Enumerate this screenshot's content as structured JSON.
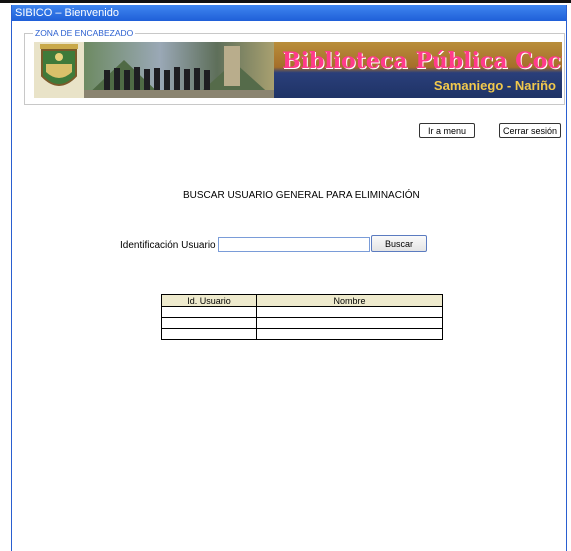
{
  "window": {
    "title": "SIBICO – Bienvenido"
  },
  "header": {
    "legend": "ZONA DE ENCABEZADO",
    "banner_title": "Biblioteca Pública Cocuyos",
    "banner_subtitle": "Samaniego - Nariño"
  },
  "nav": {
    "menu_label": "Ir a menu",
    "logout_label": "Cerrar sesión"
  },
  "search": {
    "heading": "BUSCAR USUARIO GENERAL PARA ELIMINACIÓN",
    "id_label": "Identificación Usuario",
    "id_value": "",
    "button_label": "Buscar"
  },
  "results": {
    "columns": [
      "Id. Usuario",
      "Nombre"
    ],
    "rows": [
      [
        "",
        ""
      ],
      [
        "",
        ""
      ],
      [
        "",
        ""
      ]
    ]
  }
}
